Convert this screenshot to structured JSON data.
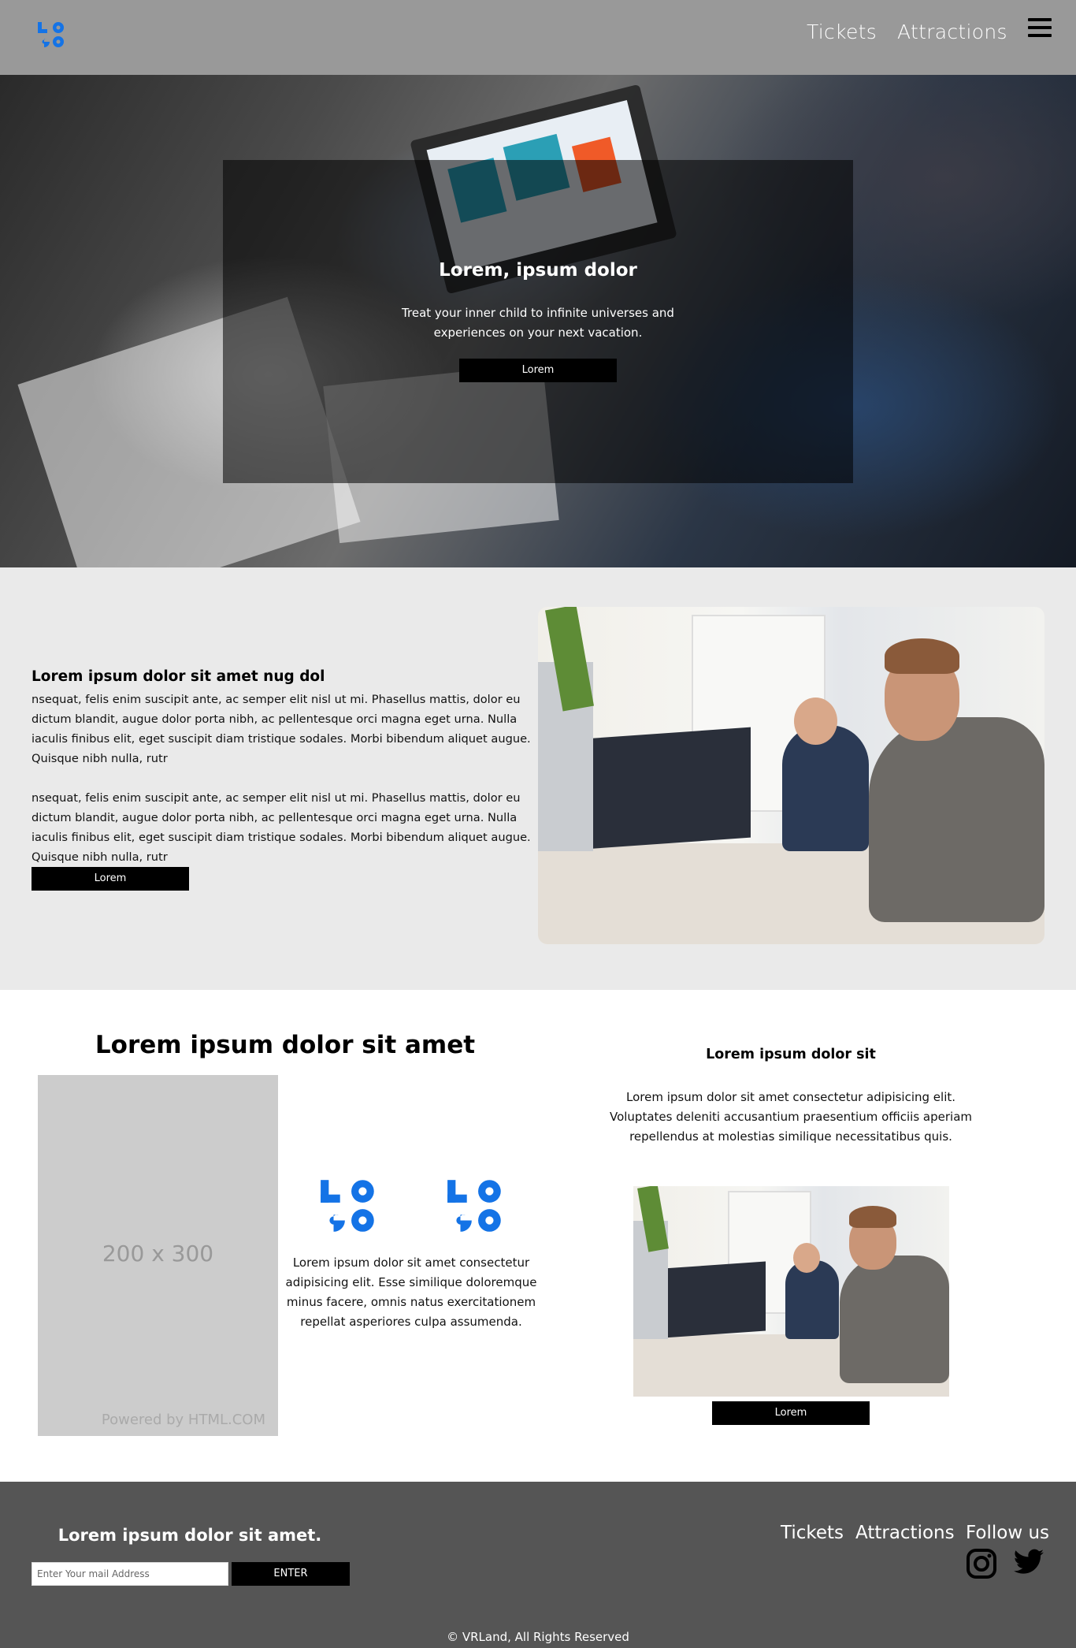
{
  "header": {
    "logo_icon": "logo-icon",
    "nav": [
      {
        "label": "Tickets"
      },
      {
        "label": "Attractions"
      }
    ],
    "menu_icon": "hamburger-menu-icon"
  },
  "hero": {
    "title": "Lorem, ipsum dolor",
    "text": "Treat your inner child to infinite universes and experiences on your next vacation.",
    "button_label": "Lorem"
  },
  "about": {
    "title": "Lorem ipsum dolor sit amet nug dol",
    "paragraph_1": "nsequat, felis enim suscipit ante, ac semper elit nisl ut mi. Phasellus mattis, dolor eu dictum blandit, augue dolor porta nibh, ac pellentesque orci magna eget urna. Nulla iaculis finibus elit, eget suscipit diam tristique sodales. Morbi bibendum aliquet augue. Quisque nibh nulla, rutr",
    "paragraph_2": "nsequat, felis enim suscipit ante, ac semper elit nisl ut mi. Phasellus mattis, dolor eu dictum blandit, augue dolor porta nibh, ac pellentesque orci magna eget urna. Nulla iaculis finibus elit, eget suscipit diam tristique sodales. Morbi bibendum aliquet augue. Quisque nibh nulla, rutr",
    "button_label": "Lorem"
  },
  "features": {
    "title": "Lorem ipsum dolor sit amet",
    "placeholder_size": "200 x 300",
    "placeholder_credit": "Powered by HTML.COM",
    "text": "Lorem ipsum dolor sit amet consectetur adipisicing elit. Esse similique doloremque minus facere, omnis natus exercitationem repellat asperiores culpa assumenda.",
    "side_title": "Lorem ipsum dolor sit",
    "side_text": "Lorem ipsum dolor sit amet consectetur adipisicing elit. Voluptates deleniti accusantium praesentium officiis aperiam repellendus at molestias similique necessitatibus quis.",
    "side_button_label": "Lorem"
  },
  "footer": {
    "title": "Lorem ipsum dolor sit amet.",
    "email_placeholder": "Enter Your mail Address",
    "button_label": "ENTER",
    "links": [
      {
        "label": "Tickets"
      },
      {
        "label": "Attractions"
      },
      {
        "label": "Follow us"
      }
    ],
    "social_icons": [
      "instagram-icon",
      "twitter-icon"
    ],
    "copyright": "© VRLand, All Rights Reserved"
  },
  "colors": {
    "header_bg": "#999999",
    "about_bg": "#eaeaea",
    "footer_bg": "#555555",
    "logo_blue": "#1473e6",
    "button_bg": "#000000"
  }
}
